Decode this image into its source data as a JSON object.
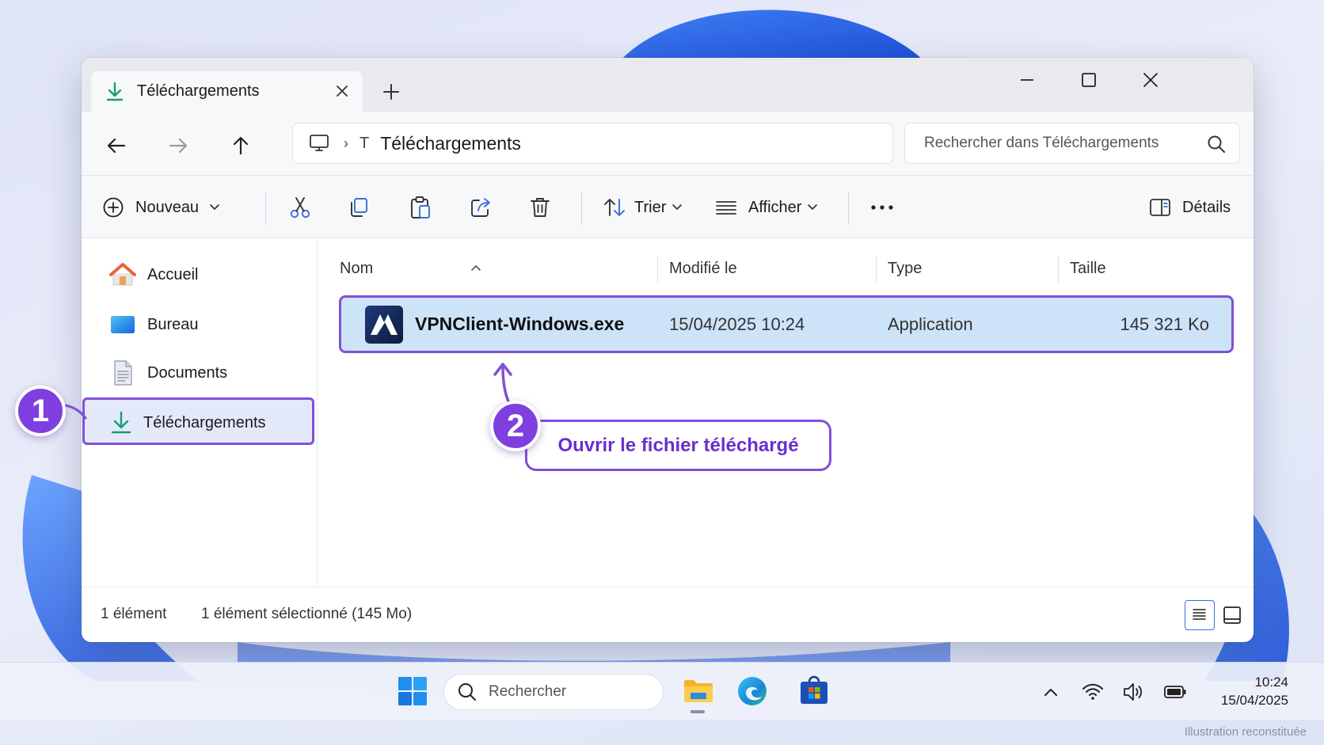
{
  "window": {
    "tab_title": "Téléchargements",
    "new_tab_symbol": "+"
  },
  "navigation": {
    "breadcrumb_t": "T",
    "breadcrumb_separator": "›",
    "breadcrumb_label": "Téléchargements",
    "search_placeholder": "Rechercher dans Téléchargements"
  },
  "toolbar": {
    "new_label": "Nouveau",
    "sort_label": "Trier",
    "view_label": "Afficher",
    "details_label": "Détails"
  },
  "sidebar": {
    "items": [
      {
        "label": "Accueil",
        "icon": "home-icon"
      },
      {
        "label": "Bureau",
        "icon": "desktop-icon"
      },
      {
        "label": "Documents",
        "icon": "documents-icon"
      },
      {
        "label": "Téléchargements",
        "icon": "download-icon",
        "selected": true
      }
    ]
  },
  "file_list": {
    "columns": [
      "Nom",
      "Modifié le",
      "Type",
      "Taille"
    ],
    "rows": [
      {
        "name": "VPNClient-Windows.exe",
        "modified": "15/04/2025 10:24",
        "type": "Application",
        "size": "145 321 Ko",
        "selected": true
      }
    ]
  },
  "status": {
    "count": "1 élément",
    "selection": "1 élément sélectionné (145 Mo)"
  },
  "annotations": {
    "step1": "1",
    "step2": "2",
    "callout": "Ouvrir le fichier téléchargé"
  },
  "taskbar": {
    "search_label": "Rechercher",
    "time": "10:24",
    "date": "15/04/2025"
  },
  "watermark": "Illustration reconstituée",
  "colors": {
    "accent_purple": "#8250d6",
    "selection_blue": "#cde3f8",
    "download_green": "#1a9e6a"
  }
}
